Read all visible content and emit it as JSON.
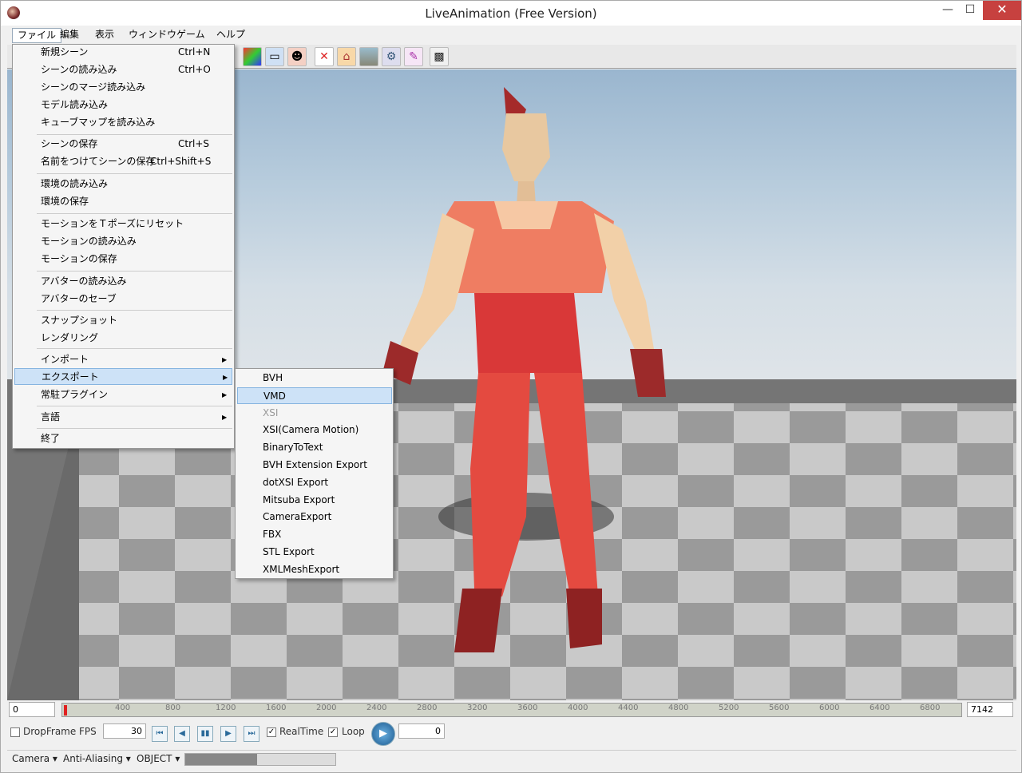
{
  "window": {
    "title": "LiveAnimation (Free Version)",
    "minimize_icon": "minimize-icon",
    "maximize_icon": "maximize-icon",
    "close_icon": "close-icon"
  },
  "menubar": {
    "items": [
      "ファイル",
      "編集",
      "表示",
      "ウィンドウ",
      "ゲーム",
      "ヘルプ"
    ],
    "open": "ファイル"
  },
  "file_menu": {
    "items": [
      {
        "label": "新規シーン",
        "shortcut": "Ctrl+N"
      },
      {
        "label": "シーンの読み込み",
        "shortcut": "Ctrl+O"
      },
      {
        "label": "シーンのマージ読み込み",
        "shortcut": ""
      },
      {
        "label": "モデル読み込み",
        "shortcut": ""
      },
      {
        "label": "キューブマップを読み込み",
        "shortcut": ""
      },
      {
        "label": "シーンの保存",
        "shortcut": "Ctrl+S"
      },
      {
        "label": "名前をつけてシーンの保存",
        "shortcut": "Ctrl+Shift+S"
      },
      {
        "label": "環境の読み込み",
        "shortcut": ""
      },
      {
        "label": "環境の保存",
        "shortcut": ""
      },
      {
        "label": "モーションをＴポーズにリセット",
        "shortcut": ""
      },
      {
        "label": "モーションの読み込み",
        "shortcut": ""
      },
      {
        "label": "モーションの保存",
        "shortcut": ""
      },
      {
        "label": "アバターの読み込み",
        "shortcut": ""
      },
      {
        "label": "アバターのセーブ",
        "shortcut": ""
      },
      {
        "label": "スナップショット",
        "shortcut": ""
      },
      {
        "label": "レンダリング",
        "shortcut": ""
      },
      {
        "label": "インポート",
        "shortcut": ""
      },
      {
        "label": "エクスポート",
        "shortcut": ""
      },
      {
        "label": "常駐プラグイン",
        "shortcut": ""
      },
      {
        "label": "言語",
        "shortcut": ""
      },
      {
        "label": "終了",
        "shortcut": ""
      }
    ],
    "highlighted": "エクスポート"
  },
  "export_submenu": {
    "items": [
      "BVH",
      "VMD",
      "XSI",
      "XSI(Camera Motion)",
      "BinaryToText",
      "BVH Extension Export",
      "dotXSI Export",
      "Mitsuba Export",
      "CameraExport",
      "FBX",
      "STL Export",
      "XMLMeshExport"
    ],
    "highlighted": "VMD",
    "disabled": [
      "XSI"
    ]
  },
  "toolbar": {
    "icons": [
      "color-chart-icon",
      "window-icon",
      "avatar-icon",
      "figure-icon",
      "house-icon",
      "landscape-icon",
      "tool-icon",
      "brush-icon",
      "camera-icon"
    ]
  },
  "timeline": {
    "start_frame": "0",
    "end_frame": "7142",
    "ticks": [
      "400",
      "800",
      "1200",
      "1600",
      "2000",
      "2400",
      "2800",
      "3200",
      "3600",
      "4000",
      "4400",
      "4800",
      "5200",
      "5600",
      "6000",
      "6400",
      "6800"
    ]
  },
  "controls": {
    "dropframe_label": "DropFrame",
    "dropframe_checked": false,
    "fps_label": "FPS",
    "fps_value": "30",
    "realtime_label": "RealTime",
    "realtime_checked": true,
    "loop_label": "Loop",
    "loop_checked": true,
    "current_frame": "0"
  },
  "statusbar": {
    "camera": "Camera",
    "antialiasing": "Anti-Aliasing",
    "object": "OBJECT"
  }
}
